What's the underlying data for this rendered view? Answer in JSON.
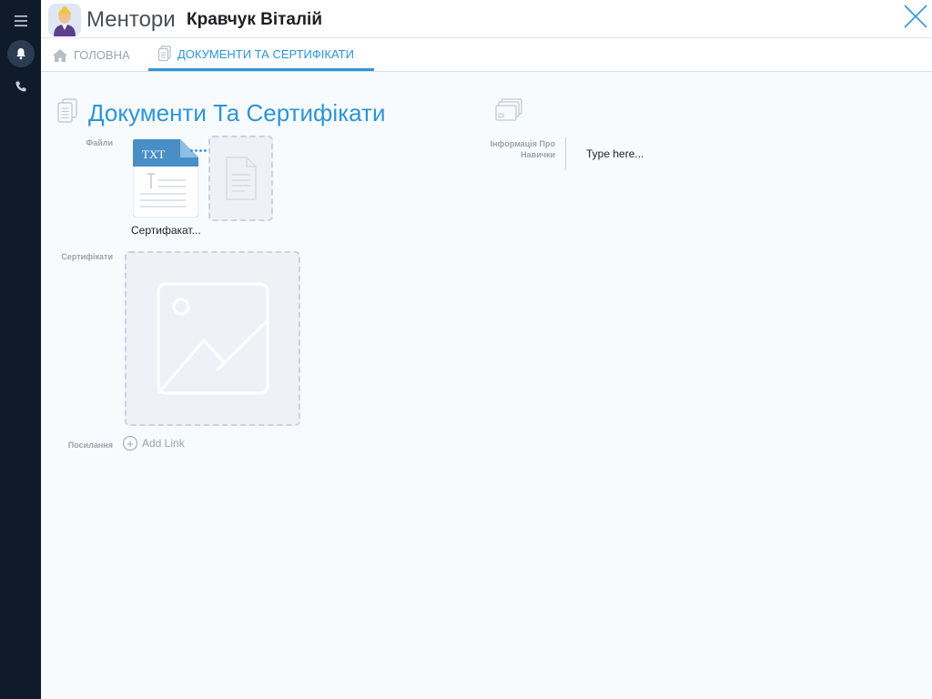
{
  "header": {
    "app_title": "Ментори",
    "user_name": "Кравчук Віталій"
  },
  "tabs": [
    {
      "label": "ГОЛОВНА",
      "icon": "home-icon",
      "active": false
    },
    {
      "label": "ДОКУМЕНТИ ТА СЕРТИФІКАТИ",
      "icon": "documents-icon",
      "active": true
    }
  ],
  "section": {
    "title": "Документи Та Сертифікати"
  },
  "fields": {
    "files_label": "Файли",
    "certificates_label": "Сертифікати",
    "links_label": "Посилання",
    "skills_label": "Інформація Про Навички",
    "skills_placeholder": "Type here...",
    "add_link_label": "Add Link"
  },
  "files": [
    {
      "name": "Сертифакат...",
      "type": "TXT"
    }
  ],
  "colors": {
    "accent": "#2d95d8",
    "rail": "#0f1a2a",
    "muted": "#9aa3ad",
    "file_badge": "#4a8ec6"
  }
}
